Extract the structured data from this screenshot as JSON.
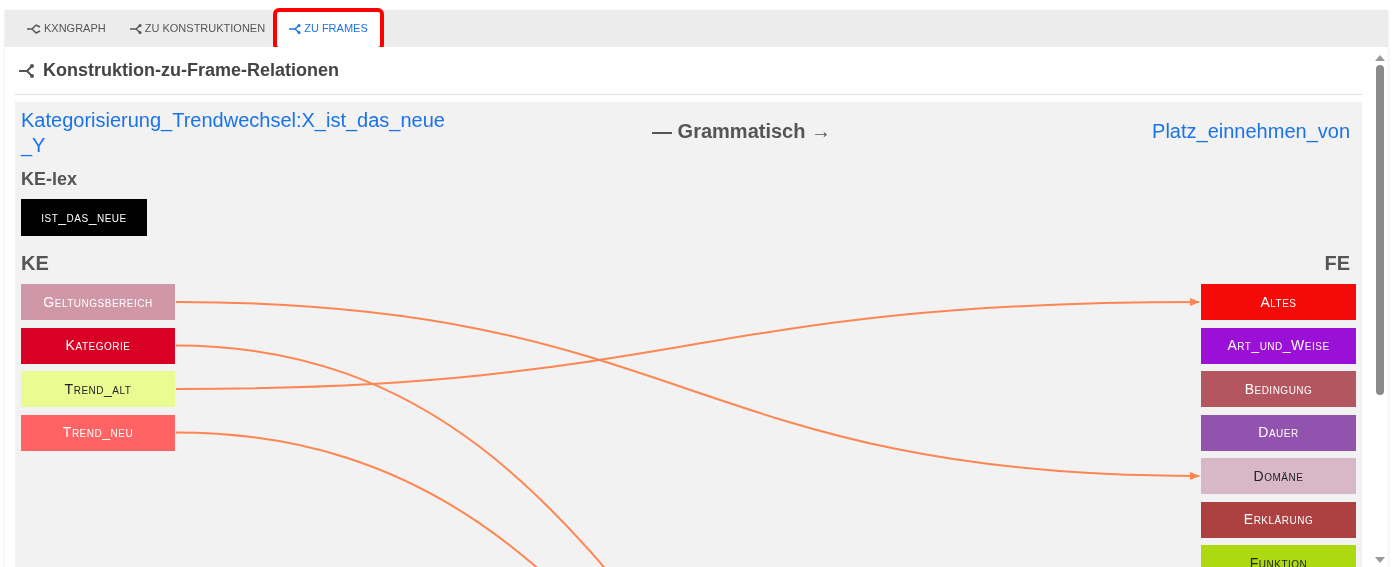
{
  "tabs": [
    {
      "label": "KXNGRAPH",
      "kind": "graph",
      "selected": false,
      "highlighted": false
    },
    {
      "label": "ZU KONSTRUKTIONEN",
      "kind": "share",
      "selected": false,
      "highlighted": false
    },
    {
      "label": "ZU FRAMES",
      "kind": "share",
      "selected": true,
      "highlighted": true
    }
  ],
  "heading": "Konstruktion-zu-Frame-Relationen",
  "construction": "Kategorisierung_Trendwechsel:X_ist_das_neue_Y",
  "relation": "— Grammatisch →",
  "frame": "Platz_einnehmen_von",
  "ke_lex": {
    "label": "KE-lex",
    "items": [
      {
        "name": "ist_das_neue",
        "color": "#000000"
      }
    ]
  },
  "ke": {
    "label": "KE",
    "items": [
      {
        "name": "Geltungsbereich",
        "color": "#d097a8",
        "kind": "arrow"
      },
      {
        "name": "Kategorie",
        "color": "#d80024",
        "kind": "offscreen"
      },
      {
        "name": "Trend_alt",
        "color": "#eafb92",
        "kind": "arrow"
      },
      {
        "name": "Trend_neu",
        "color": "#ff6363",
        "kind": "offscreen"
      }
    ]
  },
  "fe": {
    "label": "FE",
    "items": [
      {
        "name": "Altes",
        "color": "#f50a0a",
        "linked": true
      },
      {
        "name": "Art_und_Weise",
        "color": "#9a10d6",
        "linked": false
      },
      {
        "name": "Bedingung",
        "color": "#b3565f",
        "linked": false
      },
      {
        "name": "Dauer",
        "color": "#9153ad",
        "linked": false
      },
      {
        "name": "Domäne",
        "color": "#d8b8c6",
        "linked": true
      },
      {
        "name": "Erklärung",
        "color": "#ad4040",
        "linked": false
      },
      {
        "name": "Funktion",
        "color": "#acd90f",
        "linked": false
      }
    ]
  }
}
